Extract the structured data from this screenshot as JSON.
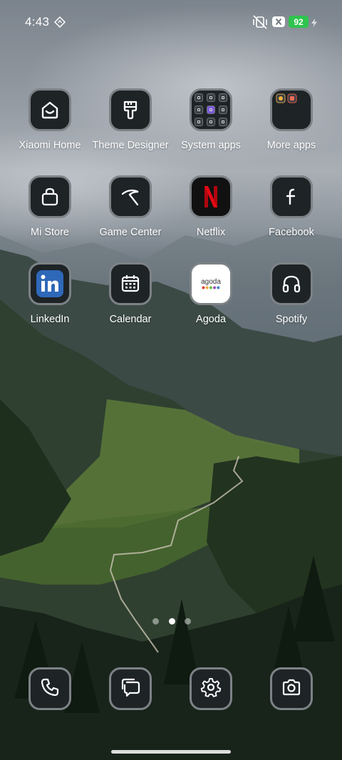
{
  "status_bar": {
    "time": "4:43",
    "battery_level": "92",
    "battery_color": "#2fc44e",
    "icons": [
      "navigation-diamond-icon",
      "vibrate-off-icon",
      "x-box-icon",
      "charging-bolt-icon"
    ]
  },
  "apps": {
    "xiaomi_home": {
      "label": "Xiaomi Home",
      "icon": "house-smile-icon"
    },
    "theme_designer": {
      "label": "Theme Designer",
      "icon": "paint-brush-icon"
    },
    "system_apps": {
      "label": "System apps",
      "icon": "folder-grid-icon"
    },
    "more_apps": {
      "label": "More apps",
      "icon": "folder-icon"
    },
    "mi_store": {
      "label": "Mi Store",
      "icon": "shopping-bag-icon"
    },
    "game_center": {
      "label": "Game Center",
      "icon": "pickaxe-swoosh-icon"
    },
    "netflix": {
      "label": "Netflix",
      "icon": "netflix-n-icon",
      "color": "#e50914"
    },
    "facebook": {
      "label": "Facebook",
      "icon": "facebook-f-icon"
    },
    "linkedin": {
      "label": "LinkedIn",
      "icon": "linkedin-in-icon",
      "color": "#2e68b9"
    },
    "calendar": {
      "label": "Calendar",
      "icon": "calendar-icon"
    },
    "agoda": {
      "label": "Agoda",
      "icon": "agoda-logo-icon",
      "logo_text": "agoda"
    },
    "spotify": {
      "label": "Spotify",
      "icon": "headphones-icon"
    }
  },
  "page_indicator": {
    "count": 3,
    "active_index": 1
  },
  "dock": [
    {
      "name": "phone",
      "icon": "phone-icon"
    },
    {
      "name": "messages",
      "icon": "message-bubbles-icon"
    },
    {
      "name": "settings",
      "icon": "gear-icon"
    },
    {
      "name": "camera",
      "icon": "camera-icon"
    }
  ]
}
